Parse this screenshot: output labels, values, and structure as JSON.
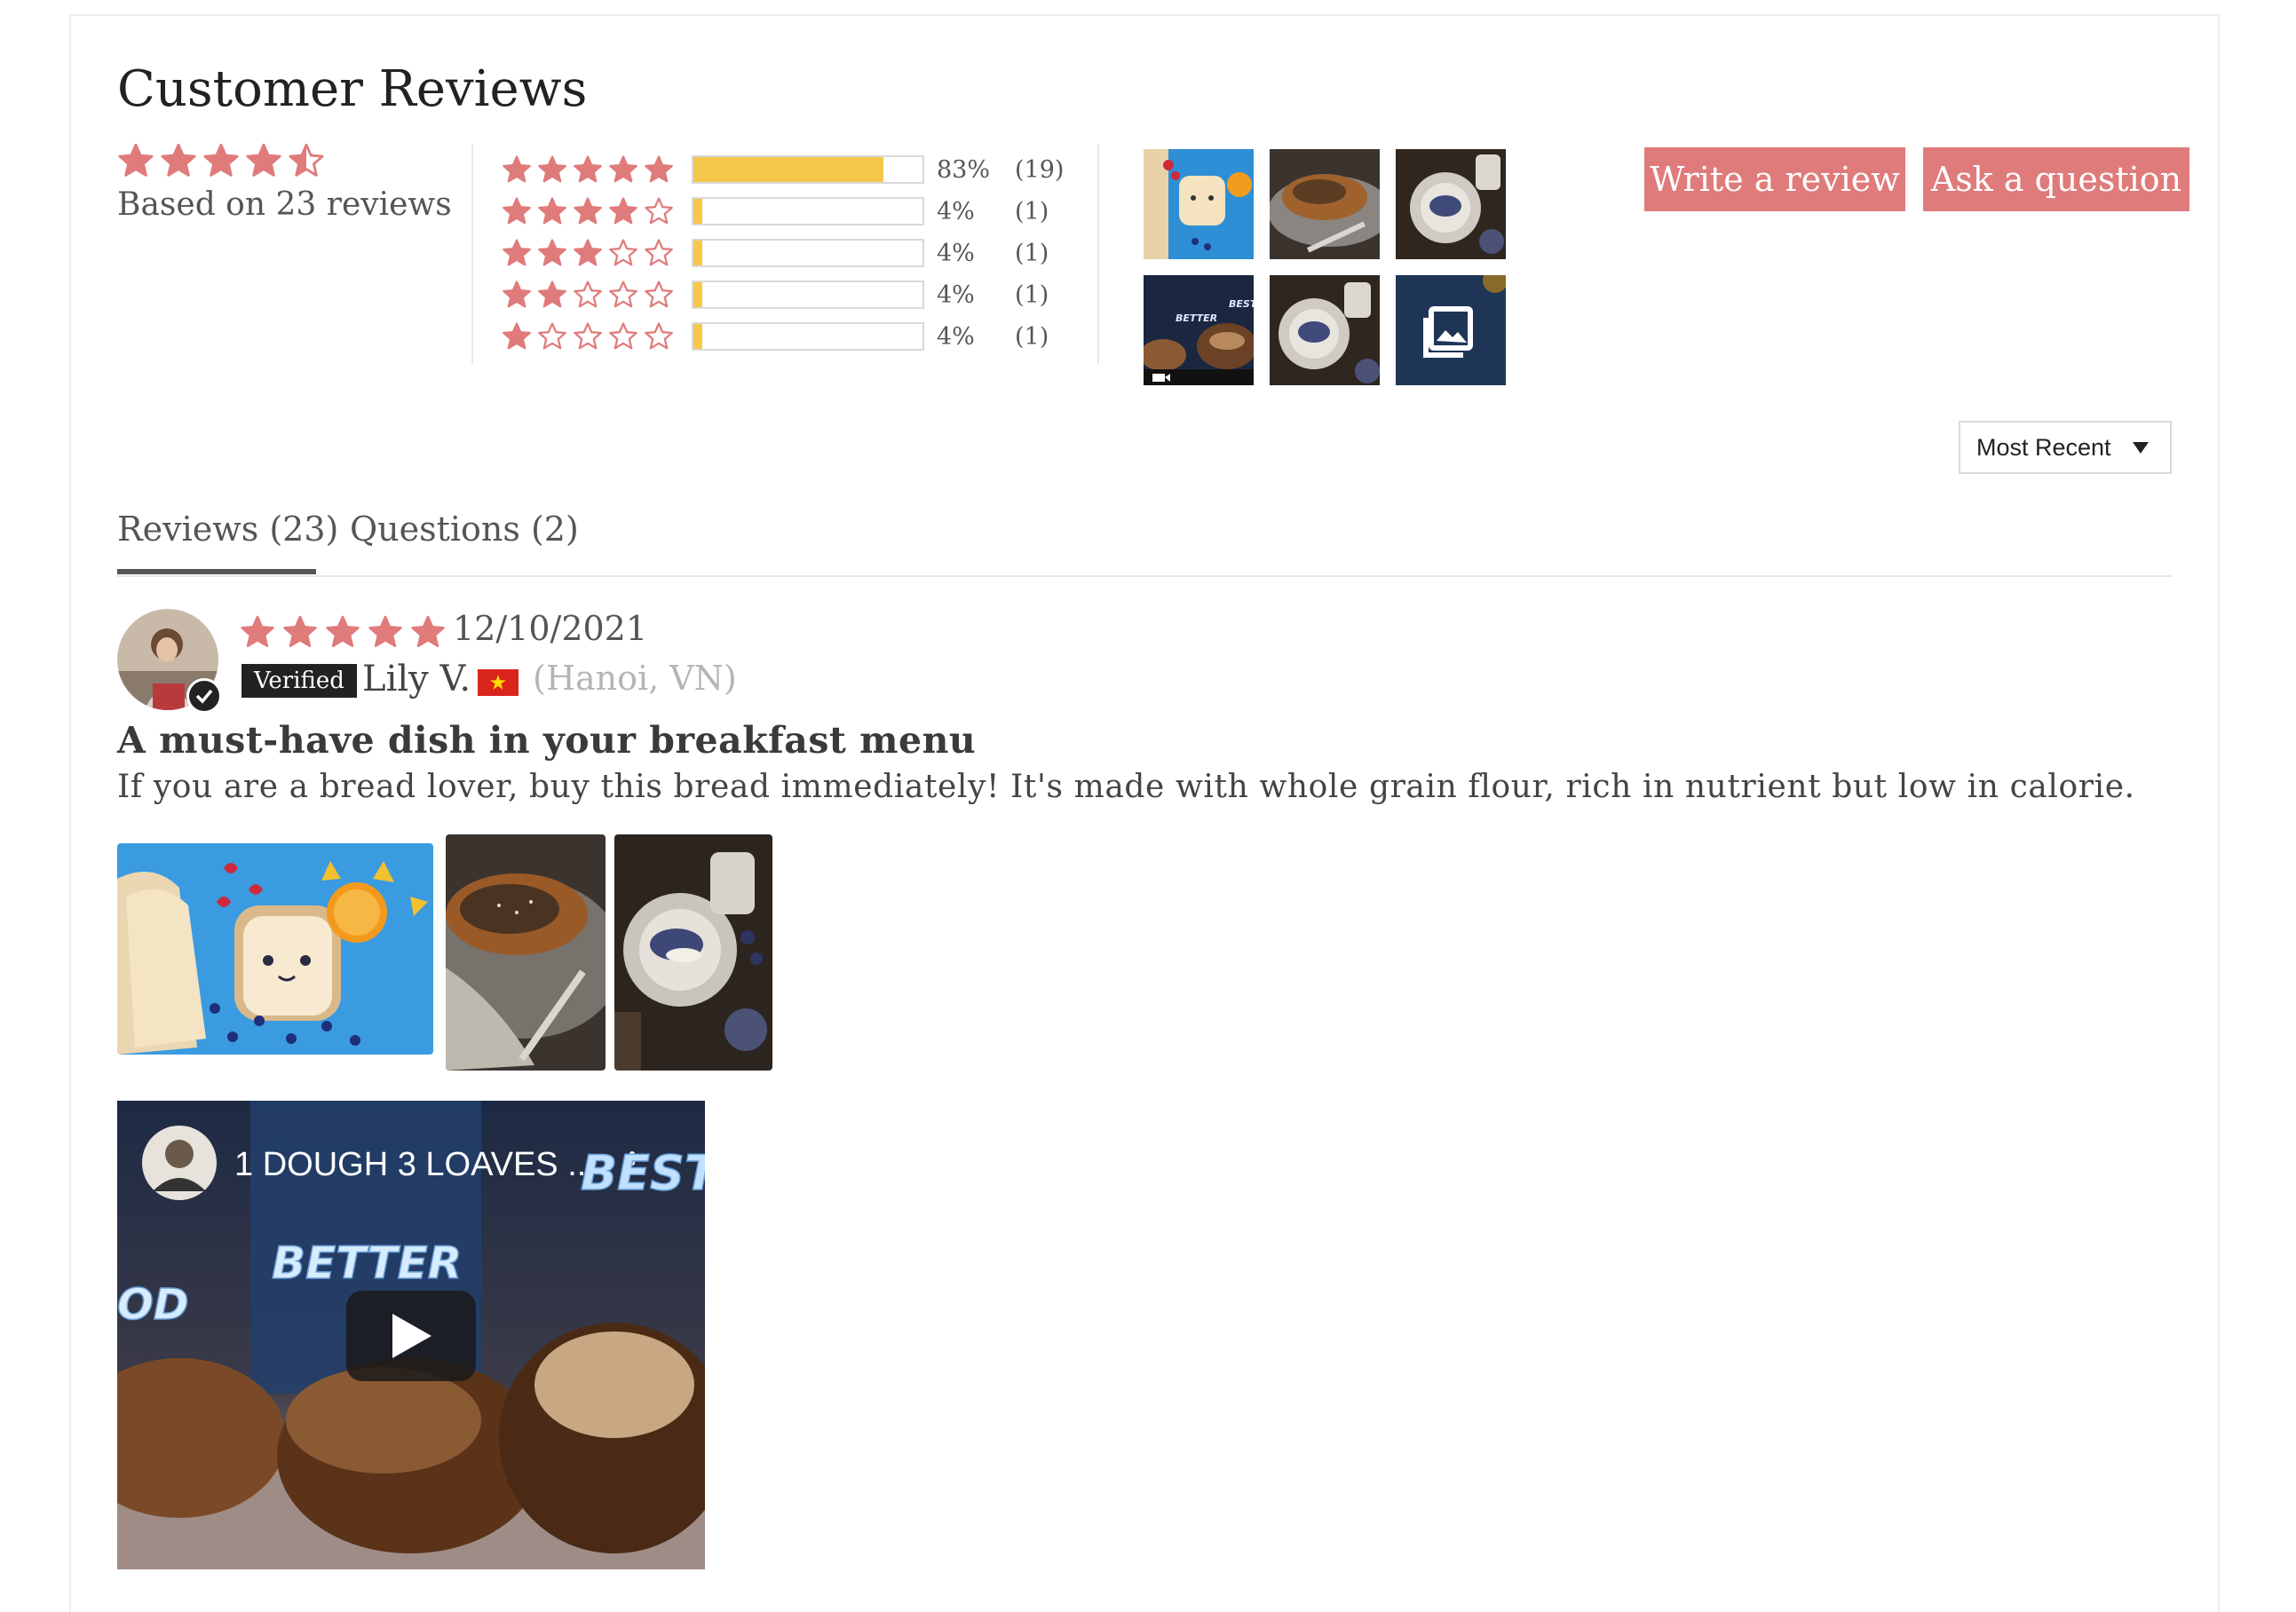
{
  "header": {
    "title": "Customer Reviews",
    "based_on": "Based on 23 reviews",
    "average_rating": 4.5
  },
  "histogram": [
    {
      "stars": 5,
      "percent": "83%",
      "count": "(19)",
      "fill": 0.83
    },
    {
      "stars": 4,
      "percent": "4%",
      "count": "(1)",
      "fill": 0.04
    },
    {
      "stars": 3,
      "percent": "4%",
      "count": "(1)",
      "fill": 0.04
    },
    {
      "stars": 2,
      "percent": "4%",
      "count": "(1)",
      "fill": 0.04
    },
    {
      "stars": 1,
      "percent": "4%",
      "count": "(1)",
      "fill": 0.04
    }
  ],
  "actions": {
    "write_review": "Write a review",
    "ask_question": "Ask a question"
  },
  "sort": {
    "selected": "Most Recent"
  },
  "tabs": [
    {
      "label": "Reviews (23)",
      "active": true
    },
    {
      "label": "Questions (2)",
      "active": false
    }
  ],
  "review": {
    "rating": 5,
    "date": "12/10/2021",
    "verified_label": "Verified",
    "author": "Lily V.",
    "location": "(Hanoi, VN)",
    "title": "A must-have dish in your breakfast menu",
    "body": "If you are a bread lover, buy this bread immediately! It's made with whole grain flour, rich in nutrient but low in calorie.",
    "video": {
      "title": "1 DOUGH 3 LOAVES ...",
      "overlay_words": [
        "BEST",
        "BETTER",
        "OD"
      ]
    }
  },
  "colors": {
    "accent": "#e07b7b",
    "bar_fill": "#f5c84b",
    "star": "#e07b7b",
    "flag": "#da251d"
  },
  "icons": {
    "gallery": "gallery-icon",
    "video": "video-camera-icon",
    "play": "play-icon",
    "verified": "check-icon",
    "sort": "caret-down-icon"
  }
}
